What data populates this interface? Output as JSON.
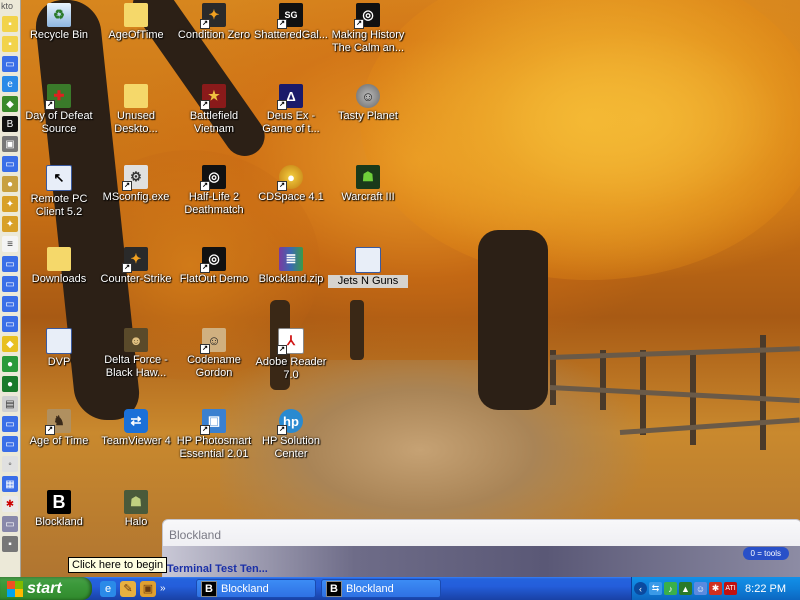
{
  "left_strip": {
    "header": "kto"
  },
  "desktop_icons": [
    {
      "label": "Recycle Bin",
      "icon": "recycle-bin-icon",
      "selected": false
    },
    {
      "label": "AgeOfTime",
      "icon": "folder-icon",
      "selected": false
    },
    {
      "label": "Condition Zero",
      "icon": "counter-strike-icon",
      "selected": false
    },
    {
      "label": "ShatteredGal...",
      "icon": "steam-sg-icon",
      "selected": false
    },
    {
      "label": "Making History The Calm an...",
      "icon": "steam-icon",
      "selected": false
    },
    {
      "label": "Day of Defeat Source",
      "icon": "day-of-defeat-icon",
      "selected": false
    },
    {
      "label": "Unused Deskto...",
      "icon": "folder-icon",
      "selected": false
    },
    {
      "label": "Battlefield Vietnam",
      "icon": "battlefield-icon",
      "selected": false
    },
    {
      "label": "Deus Ex - Game of t...",
      "icon": "deus-ex-icon",
      "selected": false
    },
    {
      "label": "Tasty Planet",
      "icon": "tasty-planet-icon",
      "selected": false
    },
    {
      "label": "Remote PC Client 5.2",
      "icon": "remote-pc-icon",
      "selected": false
    },
    {
      "label": "MSconfig.exe",
      "icon": "msconfig-icon",
      "selected": false
    },
    {
      "label": "Half-Life 2 Deathmatch",
      "icon": "steam-icon",
      "selected": false
    },
    {
      "label": "CDSpace 4.1",
      "icon": "cd-icon",
      "selected": false
    },
    {
      "label": "Warcraft III",
      "icon": "warcraft-icon",
      "selected": false
    },
    {
      "label": "Downloads",
      "icon": "folder-icon",
      "selected": false
    },
    {
      "label": "Counter-Strike",
      "icon": "counter-strike-icon",
      "selected": false
    },
    {
      "label": "FlatOut Demo",
      "icon": "steam-icon",
      "selected": false
    },
    {
      "label": "Blockland.zip",
      "icon": "winrar-icon",
      "selected": false
    },
    {
      "label": "Jets N Guns",
      "icon": "window-icon",
      "selected": true
    },
    {
      "label": "DVP",
      "icon": "window-icon",
      "selected": false
    },
    {
      "label": "Delta Force - Black Haw...",
      "icon": "delta-force-icon",
      "selected": false
    },
    {
      "label": "Codename Gordon",
      "icon": "gordon-icon",
      "selected": false
    },
    {
      "label": "Adobe Reader 7.0",
      "icon": "adobe-reader-icon",
      "selected": false
    },
    {
      "label": "Age of Time",
      "icon": "age-of-time-icon",
      "selected": false
    },
    {
      "label": "TeamViewer 4",
      "icon": "teamviewer-icon",
      "selected": false
    },
    {
      "label": "HP Photosmart Essential 2.01",
      "icon": "hp-photosmart-icon",
      "selected": false
    },
    {
      "label": "HP Solution Center",
      "icon": "hp-icon",
      "selected": false
    },
    {
      "label": "Blockland",
      "icon": "blockland-icon",
      "selected": false
    },
    {
      "label": "Halo",
      "icon": "halo-icon",
      "selected": false
    }
  ],
  "blockland_window": {
    "title": "Blockland",
    "tools_badge": "0 = tools",
    "clipped_text": "Terminal Test Ten..."
  },
  "tooltip": {
    "text": "Click here to begin"
  },
  "taskbar": {
    "start_label": "start",
    "quick_launch": [
      "ie-icon",
      "tools-icon",
      "box-icon"
    ],
    "overflow": "»",
    "tasks": [
      {
        "label": "Blockland"
      },
      {
        "label": "Blockland"
      }
    ],
    "tray_icons": [
      "back-arrow-icon",
      "network-icon",
      "sound-icon",
      "shield-icon",
      "user-icon",
      "settings-icon",
      "ati-icon"
    ],
    "clock": "8:22 PM"
  },
  "colors": {
    "taskbar_blue": "#245edb",
    "start_green": "#3c9a3c",
    "tray_blue": "#0f7fd8"
  }
}
